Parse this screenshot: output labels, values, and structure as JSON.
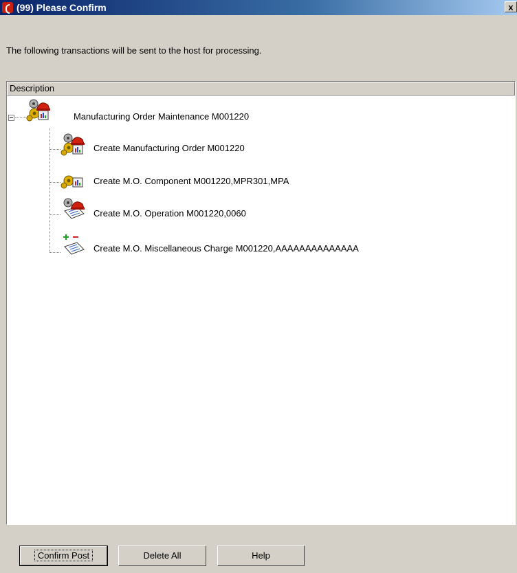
{
  "window": {
    "title": "(99) Please Confirm",
    "close_glyph": "x"
  },
  "message": "The following transactions will be sent to the host for processing.",
  "tree": {
    "column_header": "Description",
    "root": {
      "label": "Manufacturing Order Maintenance  M001220",
      "icon": "manufacturing-order-icon",
      "expanded": true
    },
    "children": [
      {
        "label": "Create Manufacturing Order  M001220",
        "icon": "manufacturing-order-icon"
      },
      {
        "label": "Create M.O. Component  M001220,MPR301,MPA",
        "icon": "component-icon"
      },
      {
        "label": "Create M.O. Operation  M001220,0060",
        "icon": "operation-icon"
      },
      {
        "label": "Create M.O. Miscellaneous Charge  M001220,AAAAAAAAAAAAAA",
        "icon": "misc-charge-icon"
      }
    ]
  },
  "buttons": {
    "confirm": "Confirm Post",
    "delete_all": "Delete All",
    "help": "Help"
  },
  "colors": {
    "dialog_bg": "#d4d0c8",
    "title_gradient_start": "#0a246a",
    "app_icon": "#c8200e"
  }
}
